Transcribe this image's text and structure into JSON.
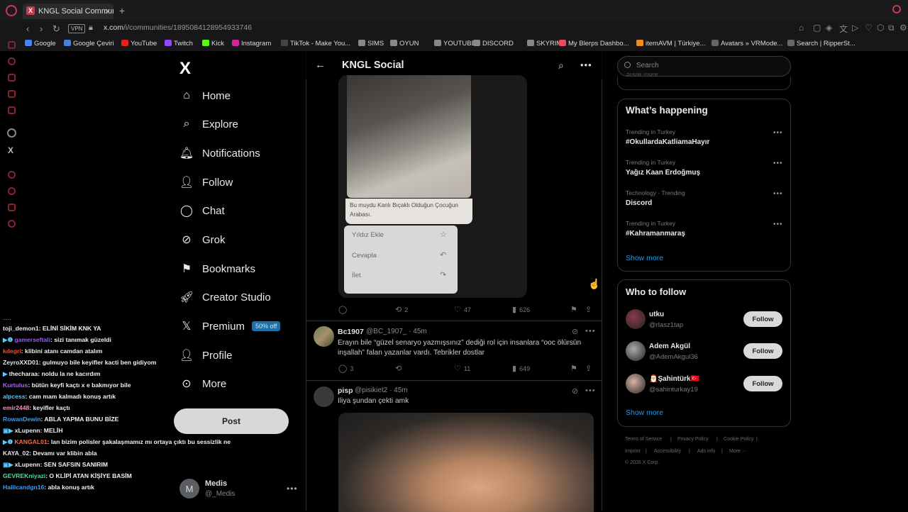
{
  "browser": {
    "tab_title": "KNGL Social Community /",
    "tab_icon": "X",
    "vpn_label": "VPN",
    "url_host": "x.com",
    "url_path": "/i/communities/1895084128954933746",
    "bookmarks": [
      {
        "label": "Google",
        "color": "#4285f4"
      },
      {
        "label": "Google Çeviri",
        "color": "#4a7fe0"
      },
      {
        "label": "YouTube",
        "color": "#e62117"
      },
      {
        "label": "Twitch",
        "color": "#9146ff"
      },
      {
        "label": "Kick",
        "color": "#53fc18"
      },
      {
        "label": "Instagram",
        "color": "#d6249f"
      },
      {
        "label": "TikTok - Make You...",
        "color": "#444"
      },
      {
        "label": "SIMS",
        "color": "#888"
      },
      {
        "label": "OYUN",
        "color": "#888"
      },
      {
        "label": "YOUTUBE",
        "color": "#888"
      },
      {
        "label": "DISCORD",
        "color": "#888"
      },
      {
        "label": "SKYRIM",
        "color": "#888"
      },
      {
        "label": "My Blerps Dashbo...",
        "color": "#e84a5f"
      },
      {
        "label": "itemAVM | Türkiye...",
        "color": "#f08c1a"
      },
      {
        "label": "Avatars » VRMode...",
        "color": "#666"
      },
      {
        "label": "Search | RipperSt...",
        "color": "#666"
      }
    ]
  },
  "nav": {
    "logo": "X",
    "items": [
      {
        "label": "Home",
        "icon": "home-icon"
      },
      {
        "label": "Explore",
        "icon": "search-icon"
      },
      {
        "label": "Notifications",
        "icon": "bell-icon"
      },
      {
        "label": "Follow",
        "icon": "add-person-icon"
      },
      {
        "label": "Chat",
        "icon": "chat-icon"
      },
      {
        "label": "Grok",
        "icon": "grok-icon"
      },
      {
        "label": "Bookmarks",
        "icon": "bookmark-icon"
      },
      {
        "label": "Creator Studio",
        "icon": "rocket-icon"
      },
      {
        "label": "Premium",
        "icon": "x-icon",
        "badge": "50% off"
      },
      {
        "label": "Profile",
        "icon": "person-icon"
      },
      {
        "label": "More",
        "icon": "more-circle-icon"
      }
    ],
    "post_label": "Post",
    "account": {
      "initial": "M",
      "name": "Medis",
      "handle": "@_Medis"
    }
  },
  "chat": {
    "lines": [
      {
        "user": "toji_demon1",
        "color": "#f1f1f1",
        "badge": "",
        "text": ": ELİNİ SİKİM KNK YA"
      },
      {
        "user": "gamerseftali",
        "color": "#9b59ff",
        "badge": "▶❶",
        "text": ": sizi tanımak güzeldi"
      },
      {
        "user": "kdegri",
        "color": "#ff4a2a",
        "badge": "",
        "text": ": klibini atanı camdan atalım"
      },
      {
        "user": "ZeyroXXD01",
        "color": "#e8e8e8",
        "badge": "",
        "text": ": gulmuyo bile keyifler kacti ben gidiyom"
      },
      {
        "user": "thecharaa",
        "color": "#f1f1f1",
        "badge": "▶",
        "text": ": noldu la ne kacırdım"
      },
      {
        "user": "Kurtulus",
        "color": "#b260ff",
        "badge": "",
        "text": ": bütün keyfi kaçtı x e bakmıyor bile"
      },
      {
        "user": "alpcess",
        "color": "#5bc8ff",
        "badge": "",
        "text": ": cam mam kalmadı konuş artık"
      },
      {
        "user": "emir2448",
        "color": "#ff8fb4",
        "badge": "",
        "text": ": keyifler kaçtı"
      },
      {
        "user": "RowanDewin",
        "color": "#3aa0ff",
        "badge": "",
        "text": ": ABLA YAPMA BUNU BİZE"
      },
      {
        "user": "xLupenn",
        "color": "#f1f1f1",
        "badge": "▣▶",
        "text": ": MELİH"
      },
      {
        "user": "KANGAL01",
        "color": "#ff6a3a",
        "badge": "▶❶",
        "text": ": lan bizim polisler şakalaşmamız mı ortaya çıktı bu sessizlik ne"
      },
      {
        "user": "KAYA_02",
        "color": "#e8e8e8",
        "badge": "",
        "text": ": Devamı var klibin abla"
      },
      {
        "user": "xLupenn",
        "color": "#f1f1f1",
        "badge": "▣▶",
        "text": ": SEN SAFSIN SANIRIM"
      },
      {
        "user": "GEVREKniyazi",
        "color": "#43e1a5",
        "badge": "",
        "text": ": O KLİPİ ATAN KİŞİYE BASİM"
      },
      {
        "user": "Halilcandgn16",
        "color": "#3aa0ff",
        "badge": "",
        "text": ": abla konuş artık"
      }
    ]
  },
  "feed": {
    "title": "KNGL Social",
    "tweet1": {
      "image_caption": "Bu muydu Kanlı Bıçaklı Olduğun Çocuğun Arabası.",
      "menu": [
        "Yıldız Ekle",
        "Cevapla",
        "İlet"
      ],
      "reposts": "2",
      "likes": "47",
      "views": "626"
    },
    "tweet2": {
      "name": "Bc1907",
      "meta": "@BC_1907_ · 45m",
      "text": "Erayın bile “güzel senaryo yazmışsınız” dediği rol için insanlara “ooc ölürsün inşallah” falan yazanlar vardı. Tebrikler dostlar",
      "replies": "3",
      "likes": "11",
      "views": "649"
    },
    "tweet3": {
      "name": "pisp",
      "meta": "@pisikiet2 · 45m",
      "text": "Iliya şundan çekti amk"
    }
  },
  "sidebar": {
    "search_placeholder": "Search",
    "old_show_more": "Show more",
    "trending_title": "What’s happening",
    "trends": [
      {
        "context": "Trending in Turkey",
        "tag": "#OkullardaKatliamaHayır"
      },
      {
        "context": "Trending in Turkey",
        "tag": "Yağız Kaan Erdoğmuş"
      },
      {
        "context": "Technology · Trending",
        "tag": "Discord"
      },
      {
        "context": "Trending in Turkey",
        "tag": "#Kahramanmaraş"
      }
    ],
    "show_more": "Show more",
    "who_title": "Who to follow",
    "follows": [
      {
        "name": "utku",
        "handle": "@rlasz1tap",
        "color": "#8a3a4a"
      },
      {
        "name": "Adem Akgül",
        "handle": "@AdemAkgul36",
        "color": "#aaa"
      },
      {
        "name": "🎅Şahintürk🇹🇷",
        "handle": "@sahinturkay19",
        "color": "#d9b3a4"
      }
    ],
    "follow_label": "Follow",
    "who_show_more": "Show more",
    "footer": [
      "Terms of Service",
      "|",
      "Privacy Policy",
      "|",
      "Cookie Policy",
      "|",
      "Imprint",
      "|",
      "Accessibility",
      "|",
      "Ads info",
      "|",
      "More ···",
      "© 2026 X Corp."
    ]
  },
  "colors": {
    "accent": "#1d9bf0",
    "browser_red": "#c63b4a",
    "premium_badge": "#1d6fa8"
  }
}
